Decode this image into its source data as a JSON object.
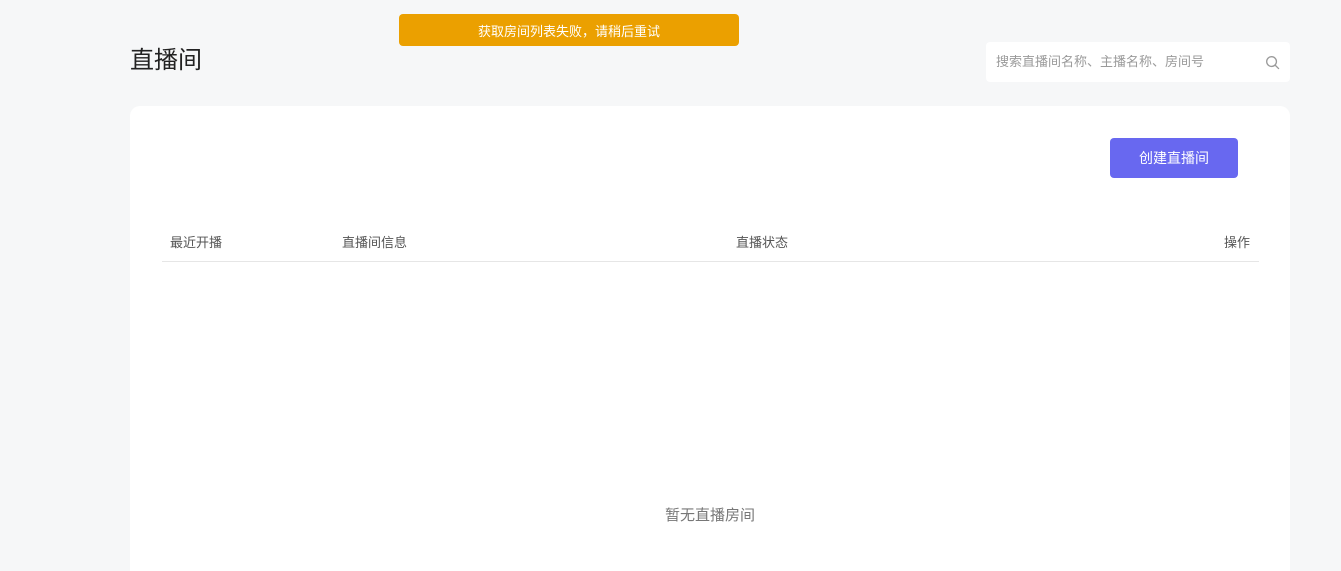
{
  "toast": {
    "message": "获取房间列表失败，请稍后重试",
    "color": "#eba000"
  },
  "header": {
    "title": "直播间"
  },
  "search": {
    "placeholder": "搜索直播间名称、主播名称、房间号",
    "value": "",
    "icon": "search-icon"
  },
  "toolbar": {
    "create_label": "创建直播间",
    "accent": "#6868f0"
  },
  "table": {
    "columns": [
      "最近开播",
      "直播间信息",
      "直播状态",
      "操作"
    ],
    "rows": [],
    "empty_text": "暂无直播房间"
  }
}
